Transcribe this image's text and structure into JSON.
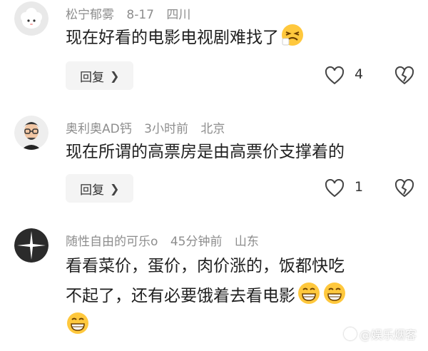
{
  "comments": [
    {
      "username": "松宁郁雾",
      "date": "8-17",
      "location": "四川",
      "text": "现在好看的电影电视剧难找了",
      "emoji": "weary-face-emoji",
      "reply_label": "回复",
      "like_count": "4"
    },
    {
      "username": "奥利奥AD钙",
      "date": "3小时前",
      "location": "北京",
      "text": "现在所谓的高票房是由高票价支撑着的",
      "reply_label": "回复",
      "like_count": "1"
    },
    {
      "username": "随性自由的可乐o",
      "date": "45分钟前",
      "location": "山东",
      "text_line1": "看看菜价，蛋价，肉价涨的，饭都快吃",
      "text_line2": "不起了，还有必要饿着去看电影",
      "emoji": "grinning-face-emoji"
    }
  ],
  "watermark": "@娱乐烟客",
  "colors": {
    "meta": "#8d8d8d",
    "reply_bg": "#f4f4f4",
    "emoji_yellow": "#ffc83d"
  }
}
